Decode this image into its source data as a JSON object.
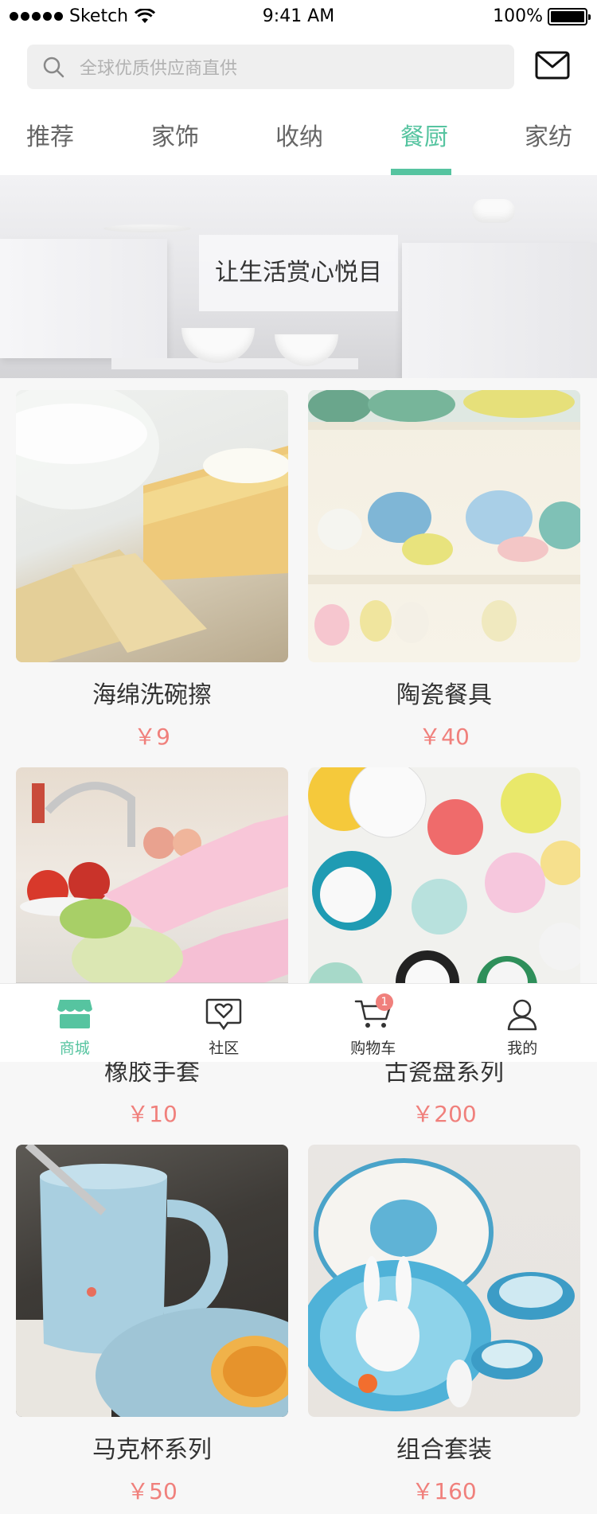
{
  "status_bar": {
    "carrier": "Sketch",
    "time": "9:41 AM",
    "battery": "100%"
  },
  "search": {
    "placeholder": "全球优质供应商直供"
  },
  "tabs": [
    {
      "label": "推荐"
    },
    {
      "label": "家饰"
    },
    {
      "label": "收纳"
    },
    {
      "label": "餐厨"
    },
    {
      "label": "家纺"
    }
  ],
  "active_tab": "餐厨",
  "banner": {
    "caption": "让生活赏心悦目"
  },
  "products": [
    {
      "name": "海绵洗碗擦",
      "price": "￥9",
      "image_icon": "sponge-image"
    },
    {
      "name": "陶瓷餐具",
      "price": "￥40",
      "image_icon": "ceramic-tableware-image"
    },
    {
      "name": "橡胶手套",
      "price": "￥10",
      "image_icon": "rubber-gloves-image"
    },
    {
      "name": "古瓷盘系列",
      "price": "￥200",
      "image_icon": "ceramic-plates-image"
    },
    {
      "name": "马克杯系列",
      "price": "￥50",
      "image_icon": "mug-image"
    },
    {
      "name": "组合套装",
      "price": "￥160",
      "image_icon": "combo-set-image"
    }
  ],
  "bottom_nav": [
    {
      "label": "商城",
      "icon": "store-icon",
      "active": true
    },
    {
      "label": "社区",
      "icon": "community-icon",
      "active": false
    },
    {
      "label": "购物车",
      "icon": "cart-icon",
      "active": false,
      "badge": "1"
    },
    {
      "label": "我的",
      "icon": "profile-icon",
      "active": false
    }
  ],
  "colors": {
    "accent": "#56c4a0",
    "price": "#f0807c",
    "background": "#f7f7f7"
  }
}
